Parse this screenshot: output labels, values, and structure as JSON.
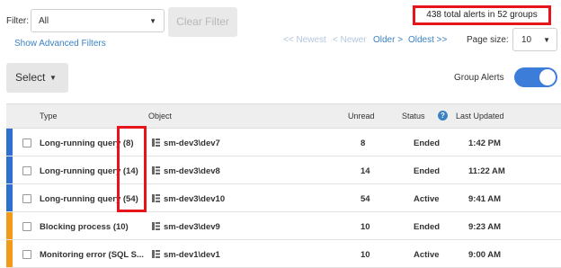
{
  "filter": {
    "label": "Filter:",
    "selected": "All",
    "clear_label": "Clear Filter",
    "advanced_link": "Show Advanced Filters"
  },
  "totals": "438 total alerts in 52 groups",
  "pagination": {
    "newest": "<< Newest",
    "newer": "< Newer",
    "older": "Older >",
    "oldest": "Oldest >>",
    "page_size_label": "Page size:",
    "page_size": "10"
  },
  "toolbar": {
    "select_label": "Select",
    "group_alerts_label": "Group Alerts",
    "group_alerts_on": true
  },
  "colors": {
    "accent": "#3b7dd8",
    "link": "#3b82c4",
    "severity_blue": "#2f6fd0",
    "severity_orange": "#f29a1a",
    "annotation_red": "#e8141c"
  },
  "table": {
    "headers": {
      "type": "Type",
      "object": "Object",
      "unread": "Unread",
      "status": "Status",
      "updated": "Last Updated"
    },
    "rows": [
      {
        "type": "Long-running query (8)",
        "object": "sm-dev3\\dev7",
        "unread": "8",
        "status": "Ended",
        "updated": "1:42 PM",
        "severity": "blue"
      },
      {
        "type": "Long-running query (14)",
        "object": "sm-dev3\\dev8",
        "unread": "14",
        "status": "Ended",
        "updated": "11:22 AM",
        "severity": "blue"
      },
      {
        "type": "Long-running query (54)",
        "object": "sm-dev3\\dev10",
        "unread": "54",
        "status": "Active",
        "updated": "9:41 AM",
        "severity": "blue"
      },
      {
        "type": "Blocking process (10)",
        "object": "sm-dev3\\dev9",
        "unread": "10",
        "status": "Ended",
        "updated": "9:23 AM",
        "severity": "orange"
      },
      {
        "type": "Monitoring error (SQL S...",
        "object": "sm-dev1\\dev1",
        "unread": "10",
        "status": "Active",
        "updated": "9:00 AM",
        "severity": "orange"
      }
    ]
  }
}
